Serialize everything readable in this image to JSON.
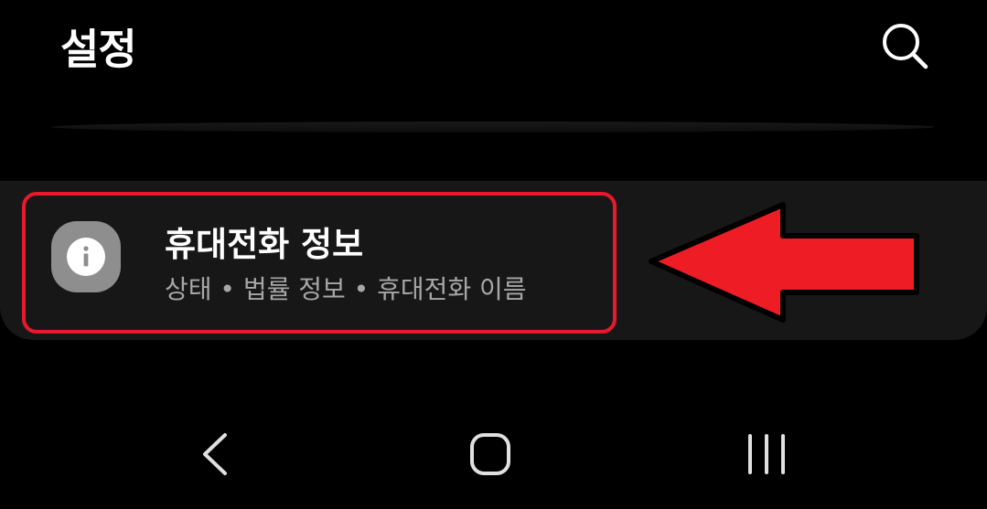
{
  "header": {
    "title": "설정"
  },
  "settings_item": {
    "title": "휴대전화 정보",
    "subtitle": "상태 • 법률 정보 • 휴대전화 이름",
    "icon": "info-icon"
  },
  "icons": {
    "search": "search-icon",
    "back": "back-icon",
    "home": "home-icon",
    "recents": "recents-icon",
    "annotation": "red-arrow-annotation"
  },
  "colors": {
    "background": "#000000",
    "card": "#171717",
    "highlight": "#e8192c",
    "arrow": "#ee1c24",
    "icon_bg": "#8e8e8e"
  }
}
